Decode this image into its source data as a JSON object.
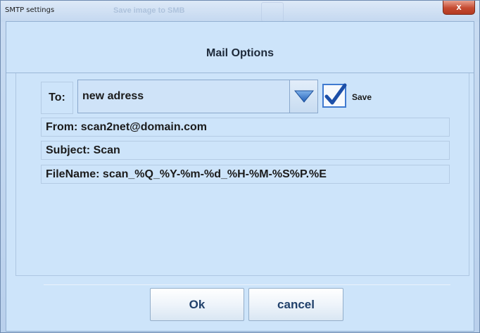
{
  "window": {
    "title": "SMTP settings",
    "background_title": "Save image to SMB",
    "close_glyph": "x"
  },
  "header": {
    "title": "Mail Options"
  },
  "form": {
    "to_label": "To:",
    "to_value": "new adress",
    "save_label": "Save",
    "save_checked": true,
    "from": "From: scan2net@domain.com",
    "subject": "Subject: Scan",
    "filename": "FileName: scan_%Q_%Y-%m-%d_%H-%M-%S%P.%E"
  },
  "buttons": {
    "ok": "Ok",
    "cancel": "cancel"
  },
  "icons": {
    "combo_arrow": "chevron-down-icon",
    "checkmark": "checkmark-icon",
    "close": "close-icon"
  },
  "colors": {
    "client_bg": "#cde4fa",
    "checkbox_border": "#3f7ad0",
    "close_button": "#c54a30",
    "button_text": "#21416b"
  }
}
